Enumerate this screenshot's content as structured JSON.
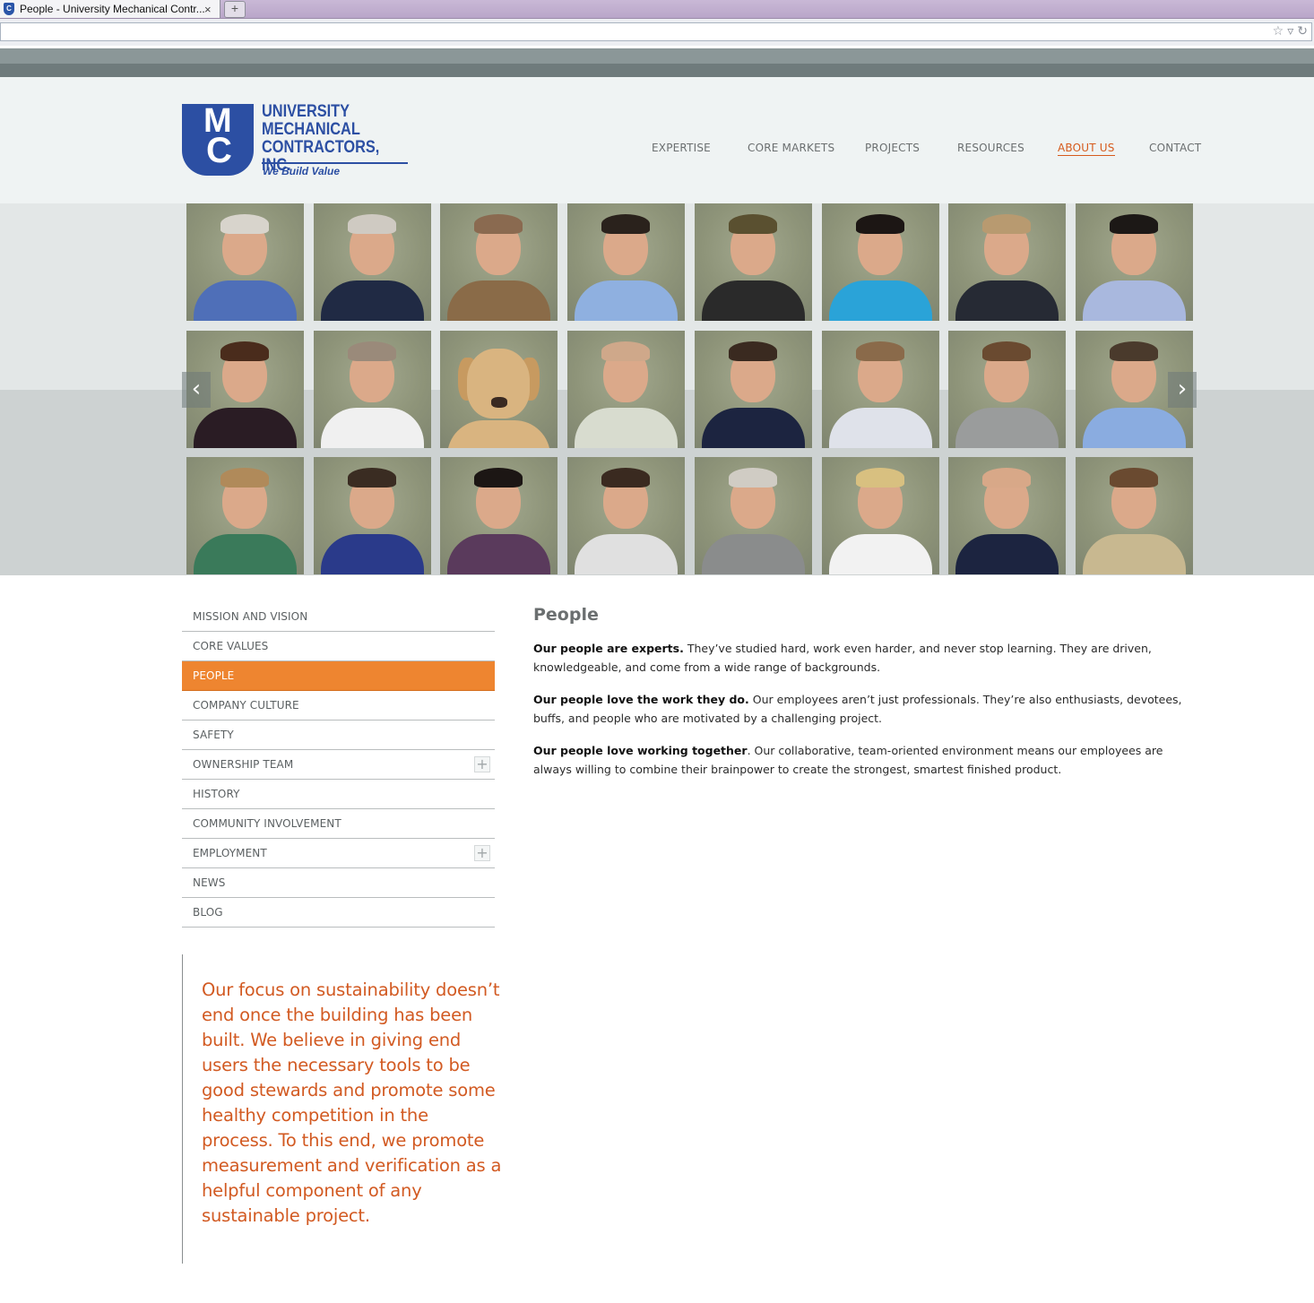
{
  "browser": {
    "tab_title": "People - University Mechanical Contr...",
    "tab_close": "×",
    "new_tab": "+",
    "address_icons": [
      "star-icon",
      "dropdown-icon",
      "reload-icon"
    ]
  },
  "logo": {
    "monogram_m": "M",
    "monogram_c": "C",
    "line1": "UNIVERSITY",
    "line2": "MECHANICAL",
    "line3": "CONTRACTORS, INC.",
    "tagline": "We Build Value",
    "brand_color": "#2c4fa3"
  },
  "nav": {
    "items": [
      {
        "label": "EXPERTISE"
      },
      {
        "label": "CORE MARKETS"
      },
      {
        "label": "PROJECTS"
      },
      {
        "label": "RESOURCES"
      },
      {
        "label": "ABOUT US",
        "active": true
      },
      {
        "label": "CONTACT"
      }
    ],
    "accent_color": "#d65a1c"
  },
  "gallery": {
    "prev_arrow": "‹",
    "next_arrow": "›",
    "photos": [
      {
        "kind": "person",
        "shirt": "#4f6fb8",
        "hair": "#d8d4cc"
      },
      {
        "kind": "person",
        "shirt": "#202a44",
        "hair": "#cfcac2"
      },
      {
        "kind": "person",
        "shirt": "#8a6b48",
        "hair": "#8a6a50"
      },
      {
        "kind": "person",
        "shirt": "#8fb0e0",
        "hair": "#2a221c"
      },
      {
        "kind": "person",
        "shirt": "#2a2a2a",
        "hair": "#5a5030"
      },
      {
        "kind": "person",
        "shirt": "#2aa3d8",
        "hair": "#1c1614"
      },
      {
        "kind": "person",
        "shirt": "#262a34",
        "hair": "#b89a70"
      },
      {
        "kind": "person",
        "shirt": "#a9b8de",
        "hair": "#1c1816"
      },
      {
        "kind": "person",
        "shirt": "#2a1c24",
        "hair": "#4a2c1c"
      },
      {
        "kind": "person",
        "shirt": "#f0f0f0",
        "hair": "#9a8a7a"
      },
      {
        "kind": "dog"
      },
      {
        "kind": "person",
        "shirt": "#d8dccf",
        "hair": "#cfa88a"
      },
      {
        "kind": "person",
        "shirt": "#1c2440",
        "hair": "#3a2a20"
      },
      {
        "kind": "person",
        "shirt": "#dfe2ea",
        "hair": "#8a6a4a"
      },
      {
        "kind": "person",
        "shirt": "#9a9c9c",
        "hair": "#6a4a30"
      },
      {
        "kind": "person",
        "shirt": "#8aace0",
        "hair": "#4a3a2c"
      },
      {
        "kind": "person",
        "shirt": "#3a7a5a",
        "hair": "#b08a5a"
      },
      {
        "kind": "person",
        "shirt": "#2a3a8a",
        "hair": "#3a2c22"
      },
      {
        "kind": "person",
        "shirt": "#5a3a5c",
        "hair": "#1c1614"
      },
      {
        "kind": "person",
        "shirt": "#e0e0e0",
        "hair": "#3a2a20"
      },
      {
        "kind": "person",
        "shirt": "#8a8c8c",
        "hair": "#d0ccc4"
      },
      {
        "kind": "person",
        "shirt": "#f2f2f2",
        "hair": "#d8c080"
      },
      {
        "kind": "person",
        "shirt": "#1c2440",
        "hair": "#d8a888"
      },
      {
        "kind": "person",
        "shirt": "#c8b890",
        "hair": "#6a4a30"
      }
    ]
  },
  "subnav": {
    "items": [
      {
        "label": "MISSION AND VISION"
      },
      {
        "label": "CORE VALUES"
      },
      {
        "label": "PEOPLE",
        "active": true
      },
      {
        "label": "COMPANY CULTURE"
      },
      {
        "label": "SAFETY"
      },
      {
        "label": "OWNERSHIP TEAM",
        "expandable": true
      },
      {
        "label": "HISTORY"
      },
      {
        "label": "COMMUNITY INVOLVEMENT"
      },
      {
        "label": "EMPLOYMENT",
        "expandable": true
      },
      {
        "label": "NEWS"
      },
      {
        "label": "BLOG"
      }
    ],
    "expand_symbol": "+",
    "active_color": "#ee8530"
  },
  "quote": {
    "text": "Our focus on sustainability doesn’t end once the building has been built. We believe in giving end users the necessary tools to be good stewards and promote some healthy competition in the process. To this end, we promote measurement and verification as a helpful component of any sustainable project."
  },
  "content": {
    "title": "People",
    "paragraphs": [
      {
        "lead": "Our people are experts.",
        "text": " They’ve studied hard, work even harder, and never stop learning. They are driven, knowledgeable, and come from a wide range of backgrounds."
      },
      {
        "lead": "Our people love the work they do.",
        "text": " Our employees aren’t just professionals. They’re also enthusiasts, devotees, buffs, and people who are motivated by a challenging project."
      },
      {
        "lead": "Our people love working together",
        "text": ". Our collaborative, team-oriented environment means our employees are always willing to combine their brainpower to create the strongest, smartest finished product."
      }
    ]
  }
}
